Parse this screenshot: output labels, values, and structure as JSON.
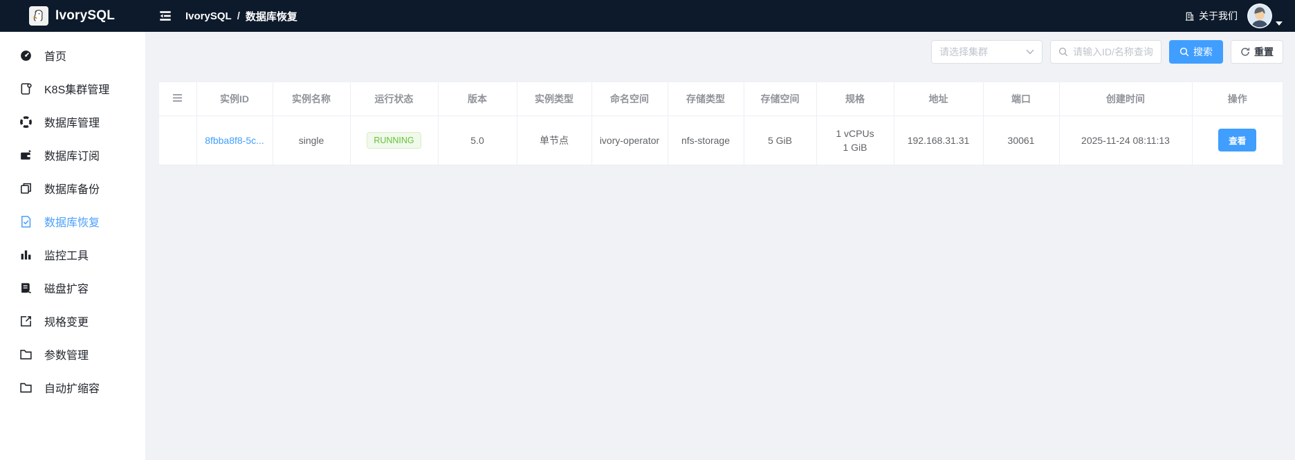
{
  "topbar": {
    "logo_text": "IvorySQL",
    "breadcrumb": {
      "items": [
        "IvorySQL",
        "数据库恢复"
      ],
      "separator": "/"
    },
    "about_label": "关于我们"
  },
  "sidebar": {
    "items": [
      {
        "label": "首页",
        "icon": "dashboard-icon",
        "active": false
      },
      {
        "label": "K8S集群管理",
        "icon": "cluster-icon",
        "active": false
      },
      {
        "label": "数据库管理",
        "icon": "database-manage-icon",
        "active": false
      },
      {
        "label": "数据库订阅",
        "icon": "database-subscribe-icon",
        "active": false
      },
      {
        "label": "数据库备份",
        "icon": "database-backup-icon",
        "active": false
      },
      {
        "label": "数据库恢复",
        "icon": "database-restore-icon",
        "active": true
      },
      {
        "label": "监控工具",
        "icon": "monitor-icon",
        "active": false
      },
      {
        "label": "磁盘扩容",
        "icon": "disk-expand-icon",
        "active": false
      },
      {
        "label": "规格变更",
        "icon": "spec-change-icon",
        "active": false
      },
      {
        "label": "参数管理",
        "icon": "folder-icon",
        "active": false
      },
      {
        "label": "自动扩缩容",
        "icon": "folder-icon",
        "active": false
      }
    ]
  },
  "filters": {
    "cluster_select_placeholder": "请选择集群",
    "search_placeholder": "请输入ID/名称查询",
    "search_button": "搜索",
    "reset_button": "重置"
  },
  "table": {
    "columns": [
      "",
      "实例ID",
      "实例名称",
      "运行状态",
      "版本",
      "实例类型",
      "命名空间",
      "存储类型",
      "存储空间",
      "规格",
      "地址",
      "端口",
      "创建时间",
      "操作"
    ],
    "rows": [
      {
        "instance_id": "8fbba8f8-5c...",
        "instance_name": "single",
        "status": "RUNNING",
        "version": "5.0",
        "instance_type": "单节点",
        "namespace": "ivory-operator",
        "storage_type": "nfs-storage",
        "storage_size": "5 GiB",
        "spec_line1": "1 vCPUs",
        "spec_line2": "1 GiB",
        "address": "192.168.31.31",
        "port": "30061",
        "created_at": "2025-11-24 08:11:13",
        "action_label": "查看"
      }
    ]
  },
  "colors": {
    "topbar_bg": "#0d1a2b",
    "accent_blue": "#409eff",
    "status_green": "#67c23a",
    "page_bg": "#f0f2f5"
  }
}
